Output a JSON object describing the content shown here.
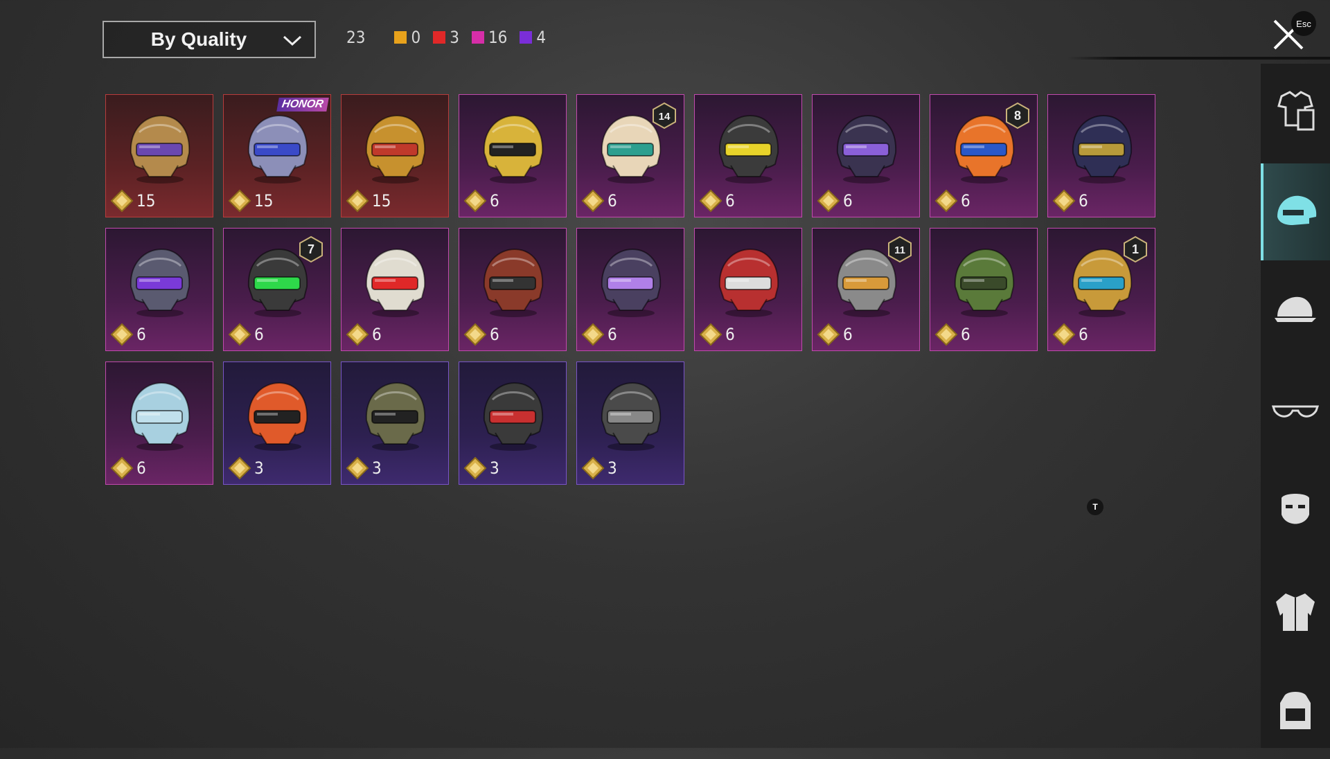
{
  "toolbar": {
    "sort_label": "By Quality",
    "total": "23",
    "quality_counts": [
      {
        "color": "#e8a21c",
        "count": "0"
      },
      {
        "color": "#e02828",
        "count": "3"
      },
      {
        "color": "#d62ea8",
        "count": "16"
      },
      {
        "color": "#7a2ed8",
        "count": "4"
      }
    ],
    "close_hotkey": "Esc"
  },
  "sidebar": {
    "items": [
      {
        "icon": "outfit-icon",
        "active": false
      },
      {
        "icon": "helmet-icon",
        "active": true
      },
      {
        "icon": "cap-icon",
        "active": false
      },
      {
        "icon": "glasses-icon",
        "active": false
      },
      {
        "icon": "mask-icon",
        "active": false
      },
      {
        "icon": "jacket-icon",
        "active": false
      },
      {
        "icon": "backpack-icon",
        "active": false
      }
    ]
  },
  "items": [
    {
      "quality": "legend",
      "cost": "15",
      "helmet_color": "#b48a4c",
      "visor": "#6a48b0"
    },
    {
      "quality": "legend",
      "cost": "15",
      "helmet_color": "#8c8fb8",
      "visor": "#3a4ac8",
      "tag": "HONOR"
    },
    {
      "quality": "legend",
      "cost": "15",
      "helmet_color": "#c7912e",
      "visor": "#c0392b"
    },
    {
      "quality": "mythic",
      "cost": "6",
      "helmet_color": "#d8b33a",
      "visor": "#222"
    },
    {
      "quality": "mythic",
      "cost": "6",
      "helmet_color": "#e8d6b8",
      "visor": "#2d9f8f",
      "level": "14"
    },
    {
      "quality": "mythic",
      "cost": "6",
      "helmet_color": "#3b3b3b",
      "visor": "#e8d32a"
    },
    {
      "quality": "mythic",
      "cost": "6",
      "helmet_color": "#3a3350",
      "visor": "#8a60d8"
    },
    {
      "quality": "mythic",
      "cost": "6",
      "helmet_color": "#e8742a",
      "visor": "#2a58c8",
      "level": "8"
    },
    {
      "quality": "mythic",
      "cost": "6",
      "helmet_color": "#2f2f55",
      "visor": "#b89a3a"
    },
    {
      "quality": "mythic",
      "cost": "6",
      "helmet_color": "#5a5a70",
      "visor": "#7a3ad8"
    },
    {
      "quality": "mythic",
      "cost": "6",
      "helmet_color": "#3a3a3a",
      "visor": "#2ed84a",
      "level": "7"
    },
    {
      "quality": "mythic",
      "cost": "6",
      "helmet_color": "#e0dcd0",
      "visor": "#e02828"
    },
    {
      "quality": "mythic",
      "cost": "6",
      "helmet_color": "#8a3a2a",
      "visor": "#333"
    },
    {
      "quality": "mythic",
      "cost": "6",
      "helmet_color": "#4a4060",
      "visor": "#b080e8"
    },
    {
      "quality": "mythic",
      "cost": "6",
      "helmet_color": "#b83030",
      "visor": "#ddd"
    },
    {
      "quality": "mythic",
      "cost": "6",
      "helmet_color": "#8a8a8a",
      "visor": "#d89a3a",
      "level": "11"
    },
    {
      "quality": "mythic",
      "cost": "6",
      "helmet_color": "#5a7a3a",
      "visor": "#3a4a2a"
    },
    {
      "quality": "mythic",
      "cost": "6",
      "helmet_color": "#c89a3a",
      "visor": "#2aa0c8",
      "level": "1"
    },
    {
      "quality": "mythic",
      "cost": "6",
      "helmet_color": "#a8d0e0",
      "visor": "#c0e0ec"
    },
    {
      "quality": "epic",
      "cost": "3",
      "helmet_color": "#e05a2a",
      "visor": "#222"
    },
    {
      "quality": "epic",
      "cost": "3",
      "helmet_color": "#6a6a4a",
      "visor": "#222"
    },
    {
      "quality": "epic",
      "cost": "3",
      "helmet_color": "#3a3a3a",
      "visor": "#c83030"
    },
    {
      "quality": "epic",
      "cost": "3",
      "helmet_color": "#4a4a4a",
      "visor": "#888"
    }
  ],
  "hotkey_hint": "T"
}
